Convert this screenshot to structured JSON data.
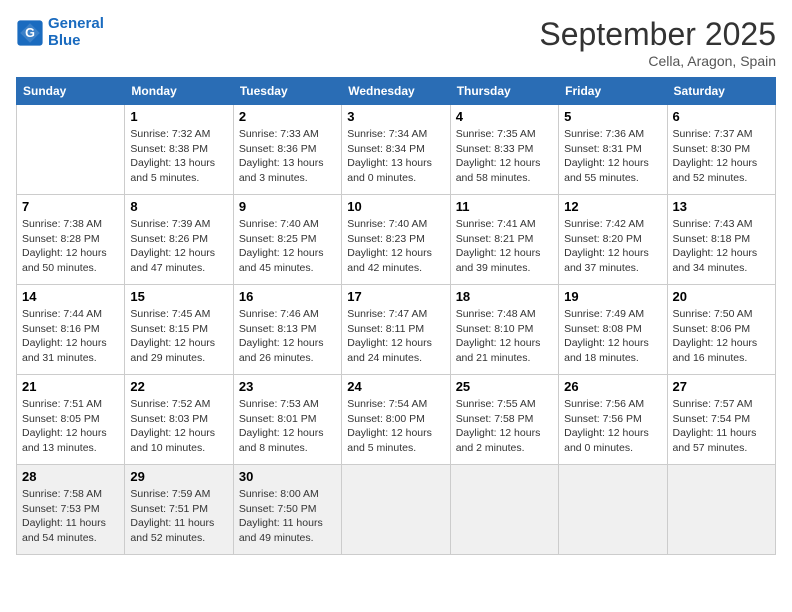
{
  "header": {
    "logo_line1": "General",
    "logo_line2": "Blue",
    "month": "September 2025",
    "location": "Cella, Aragon, Spain"
  },
  "weekdays": [
    "Sunday",
    "Monday",
    "Tuesday",
    "Wednesday",
    "Thursday",
    "Friday",
    "Saturday"
  ],
  "weeks": [
    [
      {
        "day": "",
        "info": ""
      },
      {
        "day": "1",
        "info": "Sunrise: 7:32 AM\nSunset: 8:38 PM\nDaylight: 13 hours\nand 5 minutes."
      },
      {
        "day": "2",
        "info": "Sunrise: 7:33 AM\nSunset: 8:36 PM\nDaylight: 13 hours\nand 3 minutes."
      },
      {
        "day": "3",
        "info": "Sunrise: 7:34 AM\nSunset: 8:34 PM\nDaylight: 13 hours\nand 0 minutes."
      },
      {
        "day": "4",
        "info": "Sunrise: 7:35 AM\nSunset: 8:33 PM\nDaylight: 12 hours\nand 58 minutes."
      },
      {
        "day": "5",
        "info": "Sunrise: 7:36 AM\nSunset: 8:31 PM\nDaylight: 12 hours\nand 55 minutes."
      },
      {
        "day": "6",
        "info": "Sunrise: 7:37 AM\nSunset: 8:30 PM\nDaylight: 12 hours\nand 52 minutes."
      }
    ],
    [
      {
        "day": "7",
        "info": "Sunrise: 7:38 AM\nSunset: 8:28 PM\nDaylight: 12 hours\nand 50 minutes."
      },
      {
        "day": "8",
        "info": "Sunrise: 7:39 AM\nSunset: 8:26 PM\nDaylight: 12 hours\nand 47 minutes."
      },
      {
        "day": "9",
        "info": "Sunrise: 7:40 AM\nSunset: 8:25 PM\nDaylight: 12 hours\nand 45 minutes."
      },
      {
        "day": "10",
        "info": "Sunrise: 7:40 AM\nSunset: 8:23 PM\nDaylight: 12 hours\nand 42 minutes."
      },
      {
        "day": "11",
        "info": "Sunrise: 7:41 AM\nSunset: 8:21 PM\nDaylight: 12 hours\nand 39 minutes."
      },
      {
        "day": "12",
        "info": "Sunrise: 7:42 AM\nSunset: 8:20 PM\nDaylight: 12 hours\nand 37 minutes."
      },
      {
        "day": "13",
        "info": "Sunrise: 7:43 AM\nSunset: 8:18 PM\nDaylight: 12 hours\nand 34 minutes."
      }
    ],
    [
      {
        "day": "14",
        "info": "Sunrise: 7:44 AM\nSunset: 8:16 PM\nDaylight: 12 hours\nand 31 minutes."
      },
      {
        "day": "15",
        "info": "Sunrise: 7:45 AM\nSunset: 8:15 PM\nDaylight: 12 hours\nand 29 minutes."
      },
      {
        "day": "16",
        "info": "Sunrise: 7:46 AM\nSunset: 8:13 PM\nDaylight: 12 hours\nand 26 minutes."
      },
      {
        "day": "17",
        "info": "Sunrise: 7:47 AM\nSunset: 8:11 PM\nDaylight: 12 hours\nand 24 minutes."
      },
      {
        "day": "18",
        "info": "Sunrise: 7:48 AM\nSunset: 8:10 PM\nDaylight: 12 hours\nand 21 minutes."
      },
      {
        "day": "19",
        "info": "Sunrise: 7:49 AM\nSunset: 8:08 PM\nDaylight: 12 hours\nand 18 minutes."
      },
      {
        "day": "20",
        "info": "Sunrise: 7:50 AM\nSunset: 8:06 PM\nDaylight: 12 hours\nand 16 minutes."
      }
    ],
    [
      {
        "day": "21",
        "info": "Sunrise: 7:51 AM\nSunset: 8:05 PM\nDaylight: 12 hours\nand 13 minutes."
      },
      {
        "day": "22",
        "info": "Sunrise: 7:52 AM\nSunset: 8:03 PM\nDaylight: 12 hours\nand 10 minutes."
      },
      {
        "day": "23",
        "info": "Sunrise: 7:53 AM\nSunset: 8:01 PM\nDaylight: 12 hours\nand 8 minutes."
      },
      {
        "day": "24",
        "info": "Sunrise: 7:54 AM\nSunset: 8:00 PM\nDaylight: 12 hours\nand 5 minutes."
      },
      {
        "day": "25",
        "info": "Sunrise: 7:55 AM\nSunset: 7:58 PM\nDaylight: 12 hours\nand 2 minutes."
      },
      {
        "day": "26",
        "info": "Sunrise: 7:56 AM\nSunset: 7:56 PM\nDaylight: 12 hours\nand 0 minutes."
      },
      {
        "day": "27",
        "info": "Sunrise: 7:57 AM\nSunset: 7:54 PM\nDaylight: 11 hours\nand 57 minutes."
      }
    ],
    [
      {
        "day": "28",
        "info": "Sunrise: 7:58 AM\nSunset: 7:53 PM\nDaylight: 11 hours\nand 54 minutes."
      },
      {
        "day": "29",
        "info": "Sunrise: 7:59 AM\nSunset: 7:51 PM\nDaylight: 11 hours\nand 52 minutes."
      },
      {
        "day": "30",
        "info": "Sunrise: 8:00 AM\nSunset: 7:50 PM\nDaylight: 11 hours\nand 49 minutes."
      },
      {
        "day": "",
        "info": ""
      },
      {
        "day": "",
        "info": ""
      },
      {
        "day": "",
        "info": ""
      },
      {
        "day": "",
        "info": ""
      }
    ]
  ]
}
